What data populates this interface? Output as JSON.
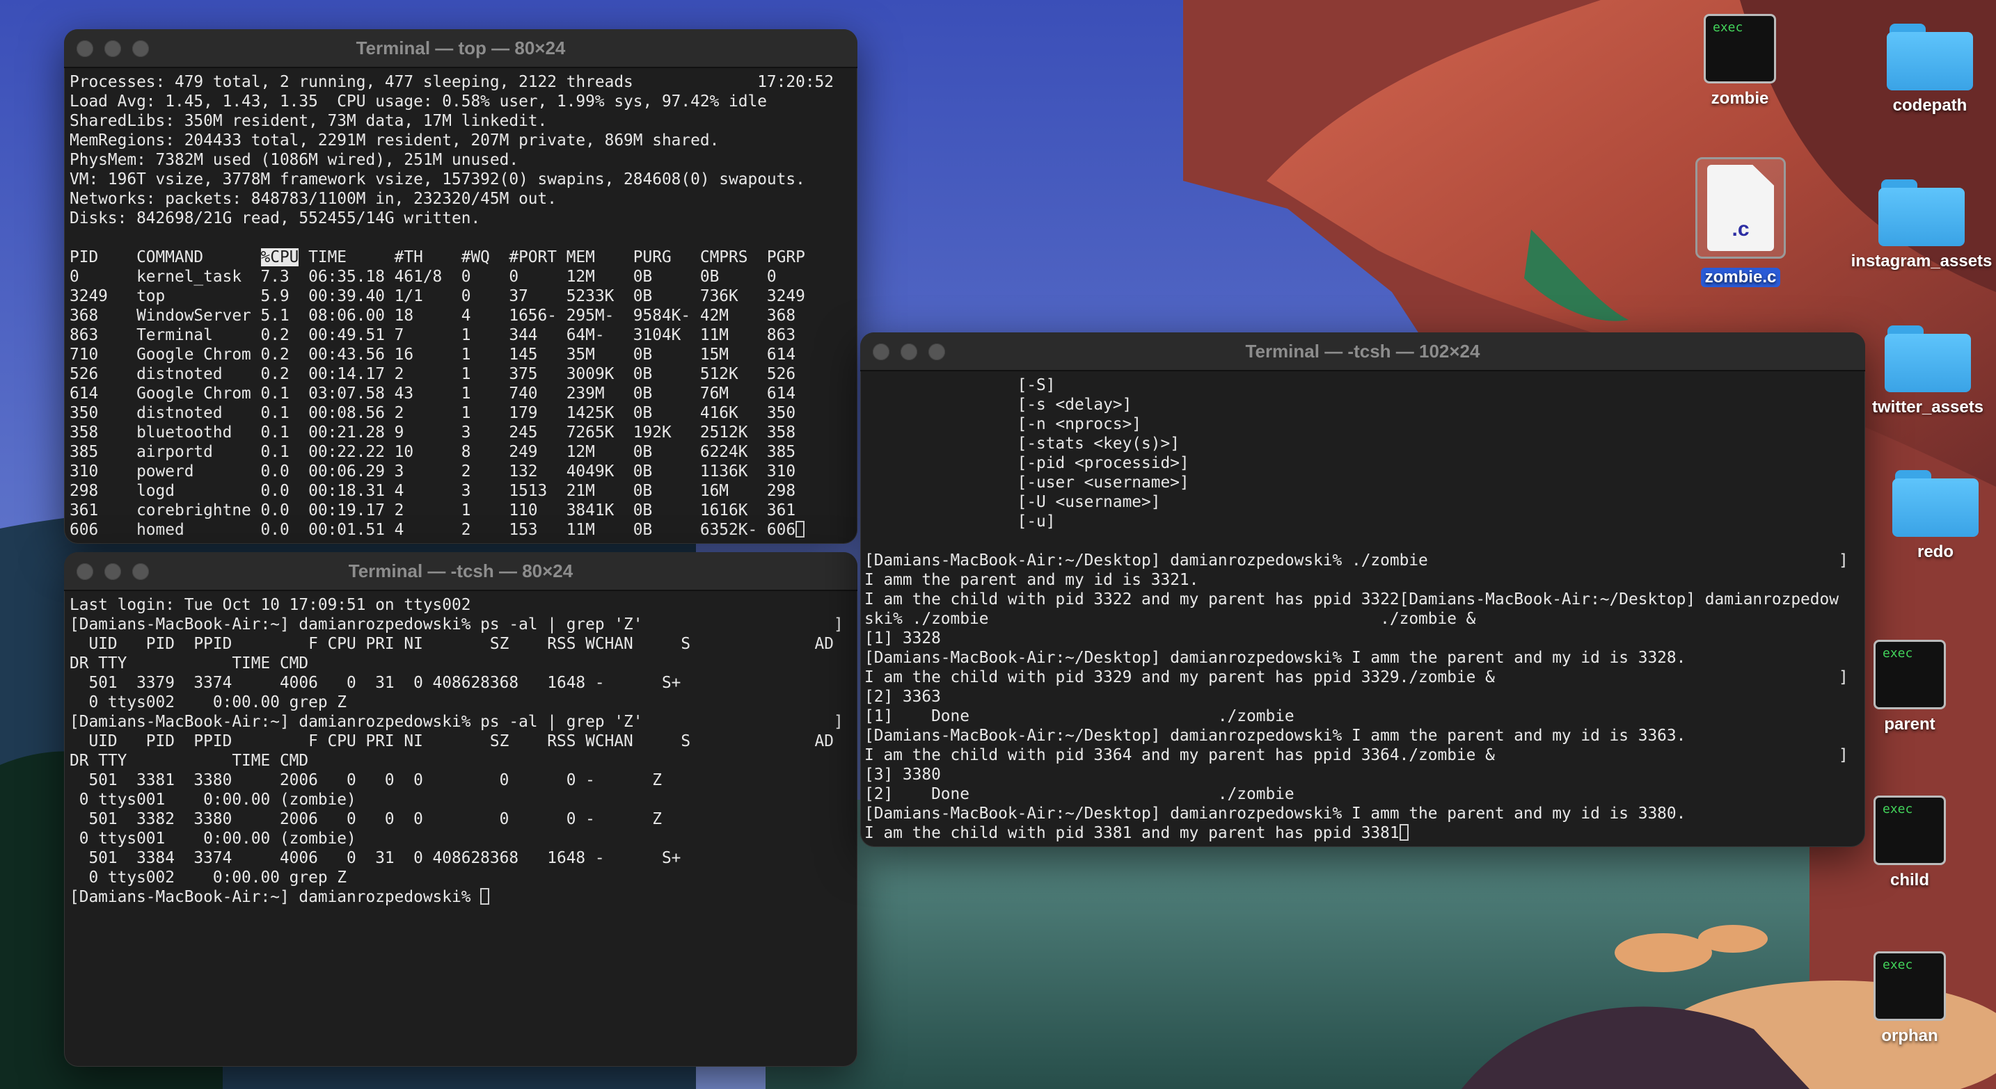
{
  "windows": {
    "top": {
      "title": "Terminal — top — 80×24",
      "lines": [
        "Processes: 479 total, 2 running, 477 sleeping, 2122 threads             17:20:52",
        "Load Avg: 1.45, 1.43, 1.35  CPU usage: 0.58% user, 1.99% sys, 97.42% idle",
        "SharedLibs: 350M resident, 73M data, 17M linkedit.",
        "MemRegions: 204433 total, 2291M resident, 207M private, 869M shared.",
        "PhysMem: 7382M used (1086M wired), 251M unused.",
        "VM: 196T vsize, 3778M framework vsize, 157392(0) swapins, 284608(0) swapouts.",
        "Networks: packets: 848783/1100M in, 232320/45M out.",
        "Disks: 842698/21G read, 552455/14G written.",
        ""
      ],
      "header_pre": "PID    COMMAND      ",
      "header_sorted": "%CPU",
      "header_post": " TIME     #TH    #WQ  #PORT MEM    PURG   CMPRS  PGRP",
      "rows": [
        "0      kernel_task  7.3  06:35.18 461/8  0    0     12M    0B     0B     0",
        "3249   top          5.9  00:39.40 1/1    0    37    5233K  0B     736K   3249",
        "368    WindowServer 5.1  08:06.00 18     4    1656- 295M-  9584K- 42M    368",
        "863    Terminal     0.2  00:49.51 7      1    344   64M-   3104K  11M    863",
        "710    Google Chrom 0.2  00:43.56 16     1    145   35M    0B     15M    614",
        "526    distnoted    0.2  00:14.17 2      1    375   3009K  0B     512K   526",
        "614    Google Chrom 0.1  03:07.58 43     1    740   239M   0B     76M    614",
        "350    distnoted    0.1  00:08.56 2      1    179   1425K  0B     416K   350",
        "358    bluetoothd   0.1  00:21.28 9      3    245   7265K  192K   2512K  358",
        "385    airportd     0.1  00:22.22 10     8    249   12M    0B     6224K  385",
        "310    powerd       0.0  00:06.29 3      2    132   4049K  0B     1136K  310",
        "298    logd         0.0  00:18.31 4      3    1513  21M    0B     16M    298",
        "361    corebrightne 0.0  00:19.17 2      1    110   3841K  0B     1616K  361",
        "606    homed        0.0  00:01.51 4      2    153   11M    0B     6352K- 606"
      ]
    },
    "tcsh_small": {
      "title": "Terminal — -tcsh — 80×24",
      "lines": [
        "Last login: Tue Oct 10 17:09:51 on ttys002",
        "[Damians-MacBook-Air:~] damianrozpedowski% ps -al | grep 'Z'                    ]",
        "  UID   PID  PPID        F CPU PRI NI       SZ    RSS WCHAN     S             AD",
        "DR TTY           TIME CMD",
        "  501  3379  3374     4006   0  31  0 408628368   1648 -      S+",
        "  0 ttys002    0:00.00 grep Z",
        "[Damians-MacBook-Air:~] damianrozpedowski% ps -al | grep 'Z'                    ]",
        "  UID   PID  PPID        F CPU PRI NI       SZ    RSS WCHAN     S             AD",
        "DR TTY           TIME CMD",
        "  501  3381  3380     2006   0   0  0        0      0 -      Z",
        " 0 ttys001    0:00.00 (zombie)",
        "  501  3382  3380     2006   0   0  0        0      0 -      Z",
        " 0 ttys001    0:00.00 (zombie)",
        "  501  3384  3374     4006   0  31  0 408628368   1648 -      S+",
        "  0 ttys002    0:00.00 grep Z"
      ],
      "prompt": "[Damians-MacBook-Air:~] damianrozpedowski% "
    },
    "tcsh_wide": {
      "title": "Terminal — -tcsh — 102×24",
      "lines": [
        "                [-S]",
        "                [-s <delay>]",
        "                [-n <nprocs>]",
        "                [-stats <key(s)>]",
        "                [-pid <processid>]",
        "                [-user <username>]",
        "                [-U <username>]",
        "                [-u]",
        "",
        "[Damians-MacBook-Air:~/Desktop] damianrozpedowski% ./zombie                                           ]",
        "I amm the parent and my id is 3321.",
        "I am the child with pid 3322 and my parent has ppid 3322[Damians-MacBook-Air:~/Desktop] damianrozpedow",
        "ski% ./zombie                                         ./zombie &",
        "[1] 3328",
        "[Damians-MacBook-Air:~/Desktop] damianrozpedowski% I amm the parent and my id is 3328.",
        "I am the child with pid 3329 and my parent has ppid 3329./zombie &                                    ]",
        "[2] 3363",
        "[1]    Done                          ./zombie",
        "[Damians-MacBook-Air:~/Desktop] damianrozpedowski% I amm the parent and my id is 3363.",
        "I am the child with pid 3364 and my parent has ppid 3364./zombie &                                    ]",
        "[3] 3380",
        "[2]    Done                          ./zombie",
        "[Damians-MacBook-Air:~/Desktop] damianrozpedowski% I amm the parent and my id is 3380."
      ],
      "last_line": "I am the child with pid 3381 and my parent has ppid 3381"
    }
  },
  "desktop_icons": [
    {
      "label": "zombie",
      "kind": "exec",
      "badge": "exec",
      "icon": "exec-icon"
    },
    {
      "label": "zombie.c",
      "kind": "c-file",
      "badge": ".c",
      "icon": "c-source-file-icon"
    },
    {
      "label": "codepath",
      "kind": "folder",
      "icon": "folder-icon"
    },
    {
      "label": "instagram_assets",
      "kind": "folder",
      "icon": "folder-icon"
    },
    {
      "label": "twitter_assets",
      "kind": "folder",
      "icon": "folder-icon"
    },
    {
      "label": "redo",
      "kind": "folder",
      "icon": "folder-icon"
    },
    {
      "label": "parent",
      "kind": "exec",
      "badge": "exec",
      "icon": "exec-icon"
    },
    {
      "label": "child",
      "kind": "exec",
      "badge": "exec",
      "icon": "exec-icon"
    },
    {
      "label": "orphan",
      "kind": "exec",
      "badge": "exec",
      "icon": "exec-icon"
    }
  ],
  "colors": {
    "terminal_bg": "#1e1e1e",
    "terminal_fg": "#e8e8e8",
    "selection_blue": "#2a5bd7",
    "folder_blue": "#4fb8f5"
  }
}
